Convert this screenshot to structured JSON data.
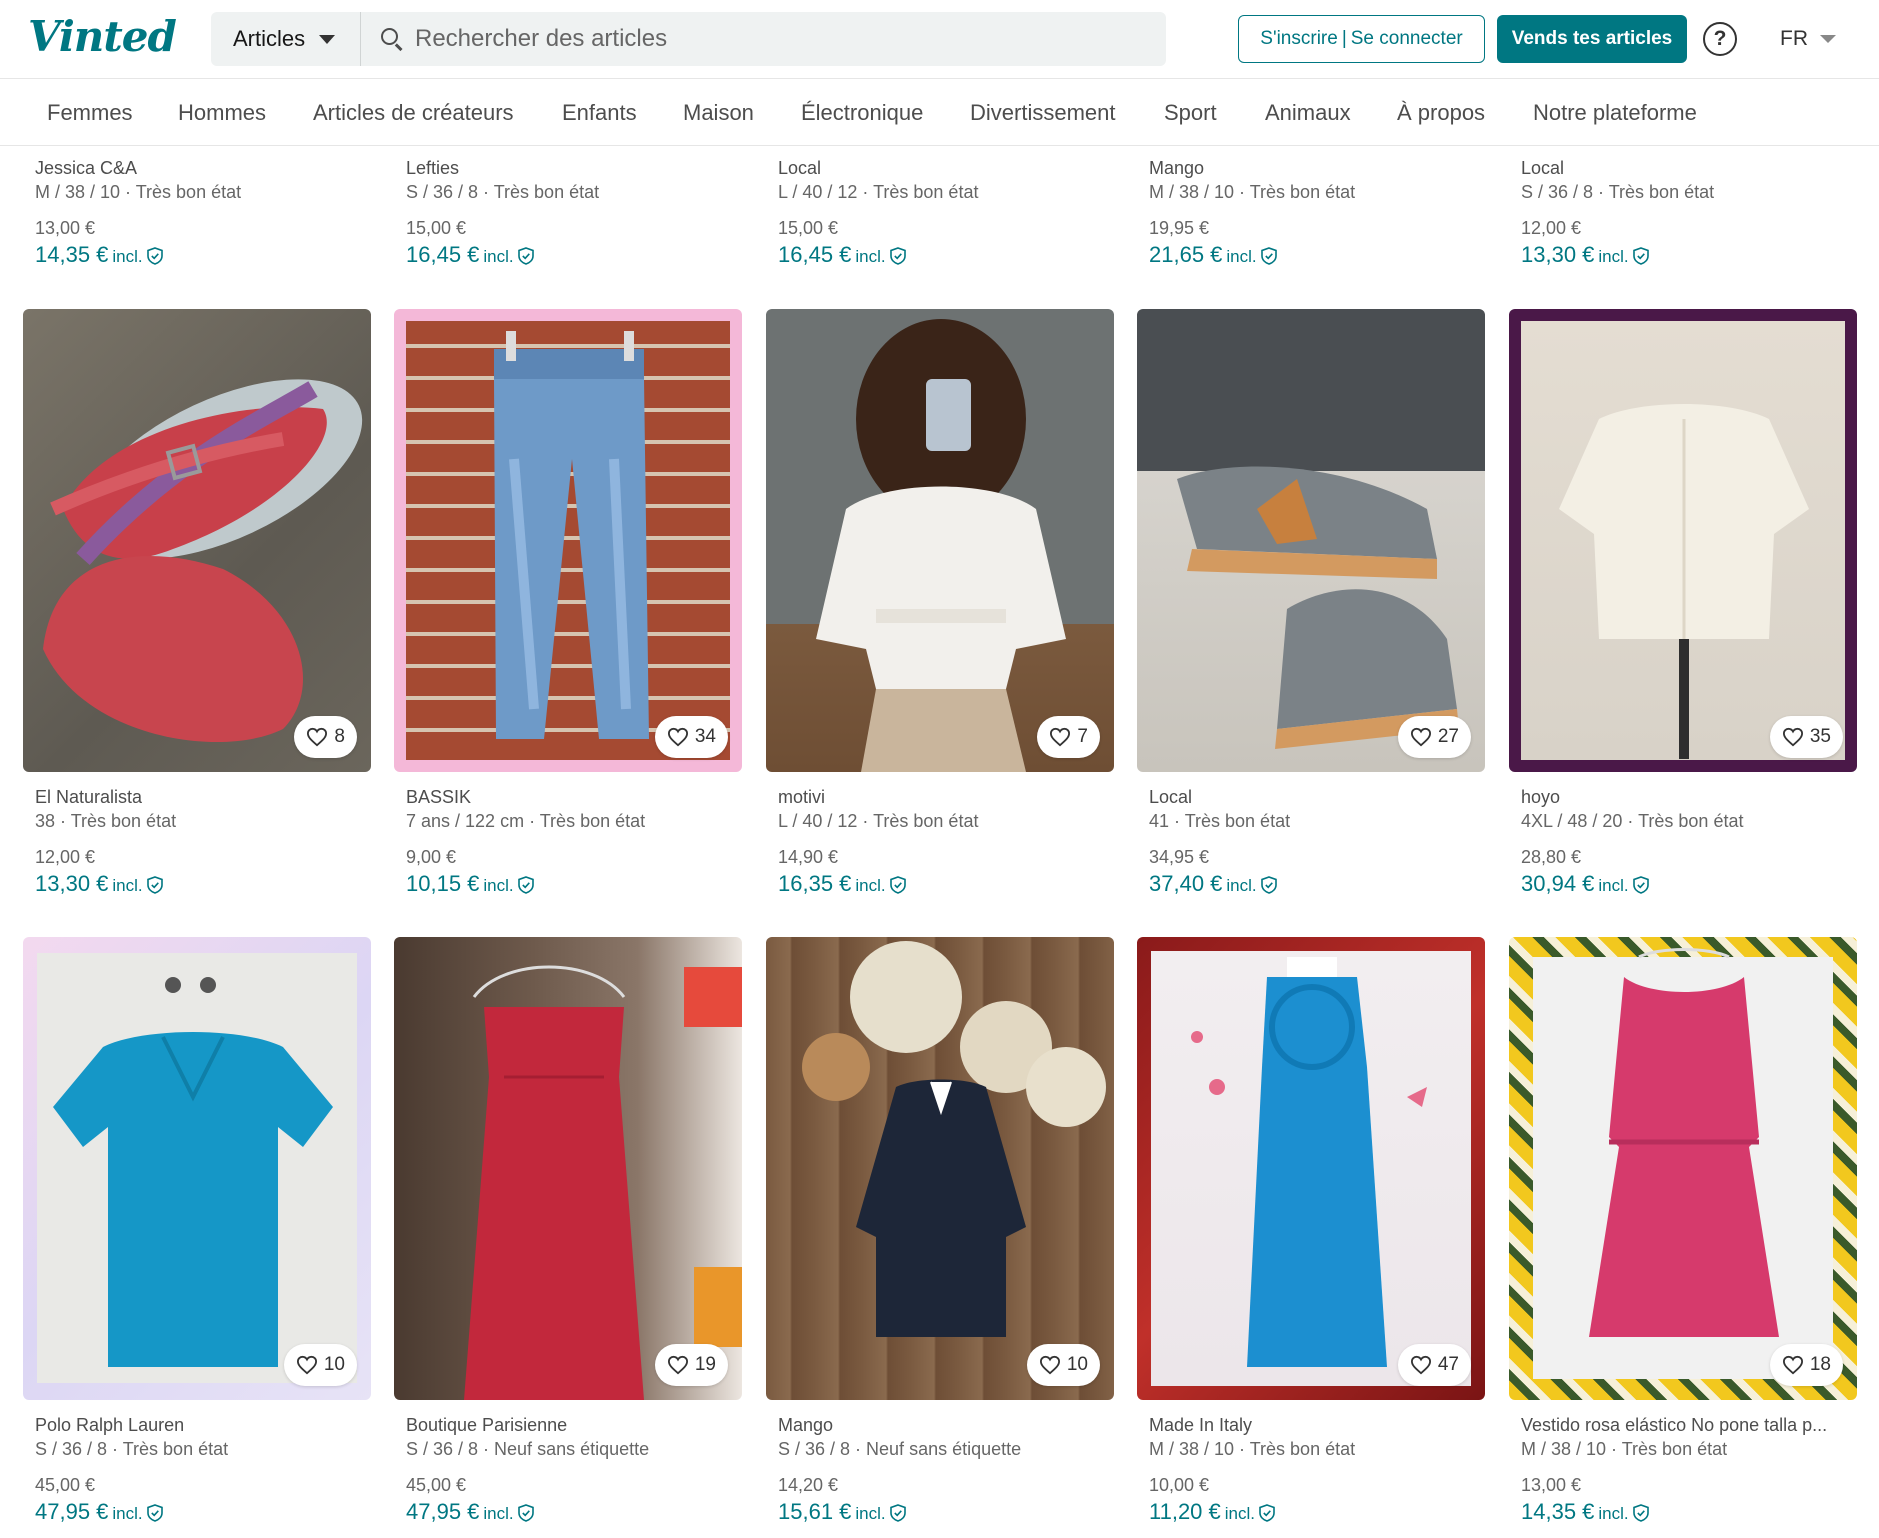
{
  "header": {
    "logo": "Vinted",
    "category_select": "Articles",
    "search_placeholder": "Rechercher des articles",
    "login_signup": "S'inscrire",
    "login_separator": "|",
    "login_connect": "Se connecter",
    "sell_button": "Vends tes articles",
    "help": "?",
    "language": "FR"
  },
  "nav": [
    "Femmes",
    "Hommes",
    "Articles de créateurs",
    "Enfants",
    "Maison",
    "Électronique",
    "Divertissement",
    "Sport",
    "Animaux",
    "À propos",
    "Notre plateforme"
  ],
  "colors": {
    "accent": "#007782"
  },
  "top_row": [
    {
      "brand": "Jessica C&A",
      "size": "M / 38 / 10 · Très bon état",
      "price": "13,00 €",
      "price_incl": "14,35 €",
      "incl": "incl."
    },
    {
      "brand": "Lefties",
      "size": "S / 36 / 8 · Très bon état",
      "price": "15,00 €",
      "price_incl": "16,45 €",
      "incl": "incl."
    },
    {
      "brand": "Local",
      "size": "L / 40 / 12 · Très bon état",
      "price": "15,00 €",
      "price_incl": "16,45 €",
      "incl": "incl."
    },
    {
      "brand": "Mango",
      "size": "M / 38 / 10 · Très bon état",
      "price": "19,95 €",
      "price_incl": "21,65 €",
      "incl": "incl."
    },
    {
      "brand": "Local",
      "size": "S / 36 / 8 · Très bon état",
      "price": "12,00 €",
      "price_incl": "13,30 €",
      "incl": "incl."
    }
  ],
  "rows": [
    [
      {
        "brand": "El Naturalista",
        "size": "38 · Très bon état",
        "price": "12,00 €",
        "price_incl": "13,30 €",
        "incl": "incl.",
        "favorites": "8"
      },
      {
        "brand": "BASSIK",
        "size": "7 ans / 122 cm · Très bon état",
        "price": "9,00 €",
        "price_incl": "10,15 €",
        "incl": "incl.",
        "favorites": "34"
      },
      {
        "brand": "motivi",
        "size": "L / 40 / 12 · Très bon état",
        "price": "14,90 €",
        "price_incl": "16,35 €",
        "incl": "incl.",
        "favorites": "7"
      },
      {
        "brand": "Local",
        "size": "41 · Très bon état",
        "price": "34,95 €",
        "price_incl": "37,40 €",
        "incl": "incl.",
        "favorites": "27"
      },
      {
        "brand": "hoyo",
        "size": "4XL / 48 / 20 · Très bon état",
        "price": "28,80 €",
        "price_incl": "30,94 €",
        "incl": "incl.",
        "favorites": "35"
      }
    ],
    [
      {
        "brand": "Polo Ralph Lauren",
        "size": "S / 36 / 8 · Très bon état",
        "price": "45,00 €",
        "price_incl": "47,95 €",
        "incl": "incl.",
        "favorites": "10"
      },
      {
        "brand": "Boutique Parisienne",
        "size": "S / 36 / 8 · Neuf sans étiquette",
        "price": "45,00 €",
        "price_incl": "47,95 €",
        "incl": "incl.",
        "favorites": "19"
      },
      {
        "brand": "Mango",
        "size": "S / 36 / 8 · Neuf sans étiquette",
        "price": "14,20 €",
        "price_incl": "15,61 €",
        "incl": "incl.",
        "favorites": "10"
      },
      {
        "brand": "Made In Italy",
        "size": "M / 38 / 10 · Très bon état",
        "price": "10,00 €",
        "price_incl": "11,20 €",
        "incl": "incl.",
        "favorites": "47"
      },
      {
        "brand": "Vestido rosa elástico No pone talla p...",
        "size": "M / 38 / 10 · Très bon état",
        "price": "13,00 €",
        "price_incl": "14,35 €",
        "incl": "incl.",
        "favorites": "18"
      }
    ]
  ]
}
